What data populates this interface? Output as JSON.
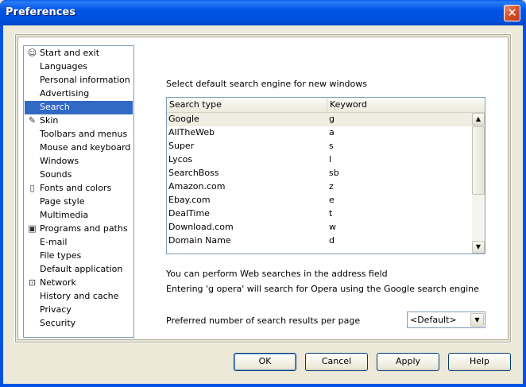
{
  "window": {
    "title": "Preferences",
    "close_glyph": "✕"
  },
  "categories": [
    {
      "label": "Start and exit",
      "icon": "person-icon",
      "glyph": "☺",
      "selected": false
    },
    {
      "label": "Languages",
      "icon": "",
      "glyph": "",
      "selected": false
    },
    {
      "label": "Personal information",
      "icon": "",
      "glyph": "",
      "selected": false
    },
    {
      "label": "Advertising",
      "icon": "",
      "glyph": "",
      "selected": false
    },
    {
      "label": "Search",
      "icon": "",
      "glyph": "",
      "selected": true
    },
    {
      "label": "Skin",
      "icon": "paint-icon",
      "glyph": "✎",
      "selected": false
    },
    {
      "label": "Toolbars and menus",
      "icon": "",
      "glyph": "",
      "selected": false
    },
    {
      "label": "Mouse and keyboard",
      "icon": "",
      "glyph": "",
      "selected": false
    },
    {
      "label": "Windows",
      "icon": "",
      "glyph": "",
      "selected": false
    },
    {
      "label": "Sounds",
      "icon": "",
      "glyph": "",
      "selected": false
    },
    {
      "label": "Fonts and colors",
      "icon": "document-icon",
      "glyph": "▯",
      "selected": false
    },
    {
      "label": "Page style",
      "icon": "",
      "glyph": "",
      "selected": false
    },
    {
      "label": "Multimedia",
      "icon": "",
      "glyph": "",
      "selected": false
    },
    {
      "label": "Programs and paths",
      "icon": "disk-icon",
      "glyph": "▣",
      "selected": false
    },
    {
      "label": "E-mail",
      "icon": "",
      "glyph": "",
      "selected": false
    },
    {
      "label": "File types",
      "icon": "",
      "glyph": "",
      "selected": false
    },
    {
      "label": "Default application",
      "icon": "",
      "glyph": "",
      "selected": false
    },
    {
      "label": "Network",
      "icon": "lock-icon",
      "glyph": "⊡",
      "selected": false
    },
    {
      "label": "History and cache",
      "icon": "",
      "glyph": "",
      "selected": false
    },
    {
      "label": "Privacy",
      "icon": "",
      "glyph": "",
      "selected": false
    },
    {
      "label": "Security",
      "icon": "",
      "glyph": "",
      "selected": false
    }
  ],
  "search": {
    "heading": "Select default search engine for new windows",
    "columns": [
      "Search type",
      "Keyword"
    ],
    "rows": [
      {
        "type": "Google",
        "keyword": "g",
        "selected": true
      },
      {
        "type": "AllTheWeb",
        "keyword": "a",
        "selected": false
      },
      {
        "type": "Super",
        "keyword": "s",
        "selected": false
      },
      {
        "type": "Lycos",
        "keyword": "l",
        "selected": false
      },
      {
        "type": "SearchBoss",
        "keyword": "sb",
        "selected": false
      },
      {
        "type": "Amazon.com",
        "keyword": "z",
        "selected": false
      },
      {
        "type": "Ebay.com",
        "keyword": "e",
        "selected": false
      },
      {
        "type": "DealTime",
        "keyword": "t",
        "selected": false
      },
      {
        "type": "Download.com",
        "keyword": "w",
        "selected": false
      },
      {
        "type": "Domain Name",
        "keyword": "d",
        "selected": false
      }
    ],
    "scroll_up_glyph": "▲",
    "scroll_down_glyph": "▼",
    "info_line1": "You can perform Web searches in the address field",
    "info_line2": "Entering 'g opera' will search for Opera using the Google search engine",
    "results_label": "Preferred number of search results per page",
    "results_value": "<Default>",
    "dropdown_glyph": "▼"
  },
  "buttons": {
    "ok": "OK",
    "cancel": "Cancel",
    "apply": "Apply",
    "help": "Help"
  }
}
